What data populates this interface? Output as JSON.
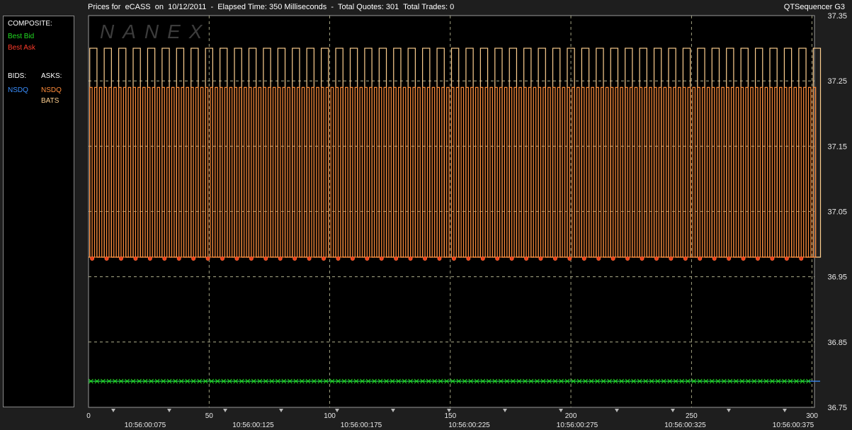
{
  "header": {
    "title": "Prices for  eCASS  on  10/12/2011  -  Elapsed Time: 350 Milliseconds  -  Total Quotes: 301  Total Trades: 0",
    "app_name": "QTSequencer G3"
  },
  "watermark": "NANEX",
  "legend": {
    "composite_label": "COMPOSITE:",
    "best_bid": "Best Bid",
    "best_ask": "Best Ask",
    "bids_label": "BIDS:",
    "asks_label": "ASKS:",
    "bid_exchanges": [
      "NSDQ"
    ],
    "ask_exchanges": [
      "NSDQ",
      "BATS"
    ]
  },
  "colors": {
    "best_bid": "#22dd22",
    "best_ask": "#e8401a",
    "nsdq_bid": "#3a8fff",
    "nsdq_ask": "#ff8c3a",
    "bats_ask": "#ffd090",
    "background": "#000000",
    "grid": "#c8c8a0"
  },
  "chart_data": {
    "type": "line",
    "xlim": [
      0,
      301
    ],
    "ylim": [
      36.75,
      37.35
    ],
    "x_ticks": [
      "0",
      "50",
      "100",
      "150",
      "200",
      "250",
      "300"
    ],
    "y_ticks": [
      "37.35",
      "37.25",
      "37.15",
      "37.05",
      "36.95",
      "36.85",
      "36.75"
    ],
    "time_labels": [
      "10:56:00:075",
      "10:56:00:125",
      "10:56:00:175",
      "10:56:00:225",
      "10:56:00:275",
      "10:56:00:325",
      "10:56:00:375"
    ],
    "grid": true,
    "series": [
      {
        "name": "NSDQ",
        "side": "ask",
        "pattern": "alternating",
        "low": 36.98,
        "high": 37.24,
        "period": 2
      },
      {
        "name": "BATS",
        "side": "ask",
        "pattern": "alternating",
        "low": 36.98,
        "high": 37.3,
        "period": 6
      },
      {
        "name": "NSDQ",
        "side": "bid",
        "pattern": "flat",
        "value": 36.79
      },
      {
        "name": "Best Bid",
        "pattern": "flat",
        "value": 36.79
      },
      {
        "name": "Best Ask",
        "pattern": "flat",
        "value": 36.98
      }
    ]
  }
}
